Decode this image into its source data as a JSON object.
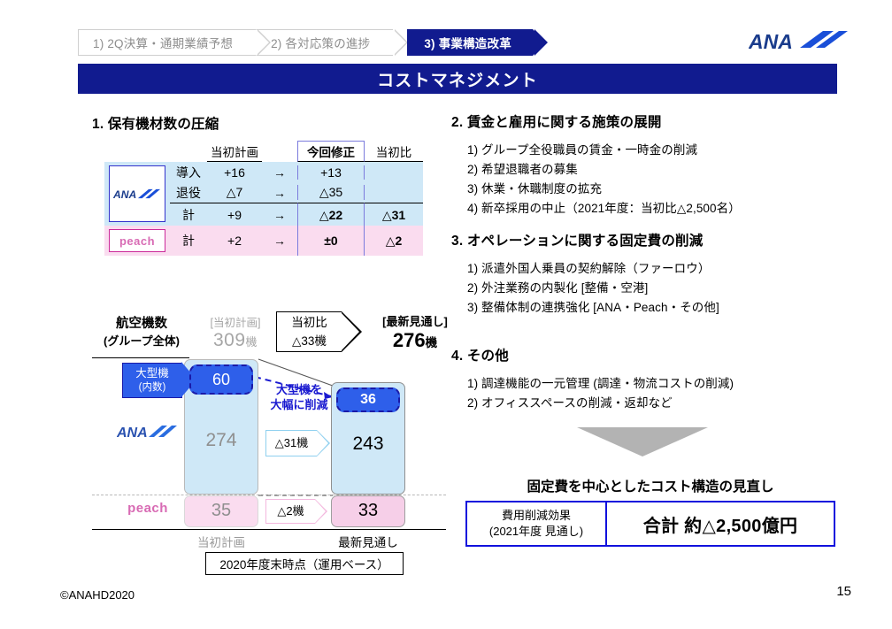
{
  "nav": {
    "items": [
      {
        "label": "1) 2Q決算・通期業績予想",
        "active": false
      },
      {
        "label": "2) 各対応策の進捗",
        "active": false
      },
      {
        "label": "3) 事業構造改革",
        "active": true
      }
    ]
  },
  "brand": {
    "name": "ANA",
    "color": "#1a3c8c"
  },
  "title": "コストマネジメント",
  "section1": {
    "heading": "1. 保有機材数の圧縮",
    "table": {
      "headers": {
        "plan": "当初計画",
        "revised": "今回修正",
        "diff": "当初比"
      },
      "ana": {
        "logo": "ANA",
        "rows": [
          {
            "label": "導入",
            "plan": "+16",
            "arrow": "→",
            "revised": "+13",
            "diff": ""
          },
          {
            "label": "退役",
            "plan": "△7",
            "arrow": "→",
            "revised": "△35",
            "diff": ""
          }
        ],
        "total": {
          "label": "計",
          "plan": "+9",
          "arrow": "→",
          "revised": "△22",
          "diff": "△31"
        }
      },
      "peach": {
        "logo": "peach",
        "total": {
          "label": "計",
          "plan": "+2",
          "arrow": "→",
          "revised": "±0",
          "diff": "△2"
        }
      }
    },
    "totals": {
      "fleet_label_line1": "航空機数",
      "fleet_label_line2": "(グループ全体)",
      "original_caption": "[当初計画]",
      "original_value": "309",
      "original_unit": "機",
      "delta_line1": "当初比",
      "delta_line2": "△33機",
      "latest_caption": "[最新見通し]",
      "latest_value": "276",
      "latest_unit": "機"
    },
    "chart_data": {
      "type": "bar",
      "title": "保有機材数の圧縮（2020年度末時点・運用ベース）",
      "categories": [
        "当初計画",
        "最新見通し"
      ],
      "series": [
        {
          "name": "ANA",
          "values": [
            274,
            243
          ]
        },
        {
          "name": "peach",
          "values": [
            35,
            33
          ]
        }
      ],
      "inner_series": {
        "name": "大型機(内数)",
        "values": [
          60,
          36
        ]
      },
      "annotations": {
        "widebody_callout_line1": "大型機",
        "widebody_callout_line2": "(内数)",
        "widebody_left": "60",
        "widebody_right": "36",
        "reduce_line1": "大型機を",
        "reduce_line2": "大幅に削減",
        "ana_delta": "△31機",
        "peach_delta": "△2機",
        "ana_left": "274",
        "ana_right": "243",
        "peach_left": "35",
        "peach_right": "33",
        "ana_mark": "ANA",
        "peach_mark": "peach",
        "xlabel_left": "当初計画",
        "xlabel_right": "最新見通し",
        "basis": "2020年度末時点（運用ベース）"
      },
      "grid": false,
      "legend": "none"
    }
  },
  "section2": {
    "heading": "2. 賃金と雇用に関する施策の展開",
    "items": [
      "1) グループ全役職員の賃金・一時金の削減",
      "2) 希望退職者の募集",
      "3) 休業・休職制度の拡充",
      "4) 新卒採用の中止（2021年度：当初比△2,500名）"
    ]
  },
  "section3": {
    "heading": "3. オペレーションに関する固定費の削減",
    "items": [
      "1) 派遣外国人乗員の契約解除（ファーロウ）",
      "2) 外注業務の内製化 [整備・空港]",
      "3) 整備体制の連携強化 [ANA・Peach・その他]"
    ]
  },
  "section4": {
    "heading": "4. その他",
    "items": [
      "1) 調達機能の一元管理 (調達・物流コストの削減)",
      "2) オフィススペースの削減・返却など"
    ]
  },
  "conclusion": {
    "heading": "固定費を中心としたコスト構造の見直し",
    "box_label_line1": "費用削減効果",
    "box_label_line2": "(2021年度 見通し)",
    "box_value": "合計 約△2,500億円"
  },
  "footer": {
    "copyright": "©ANAHD2020",
    "page": "15"
  }
}
